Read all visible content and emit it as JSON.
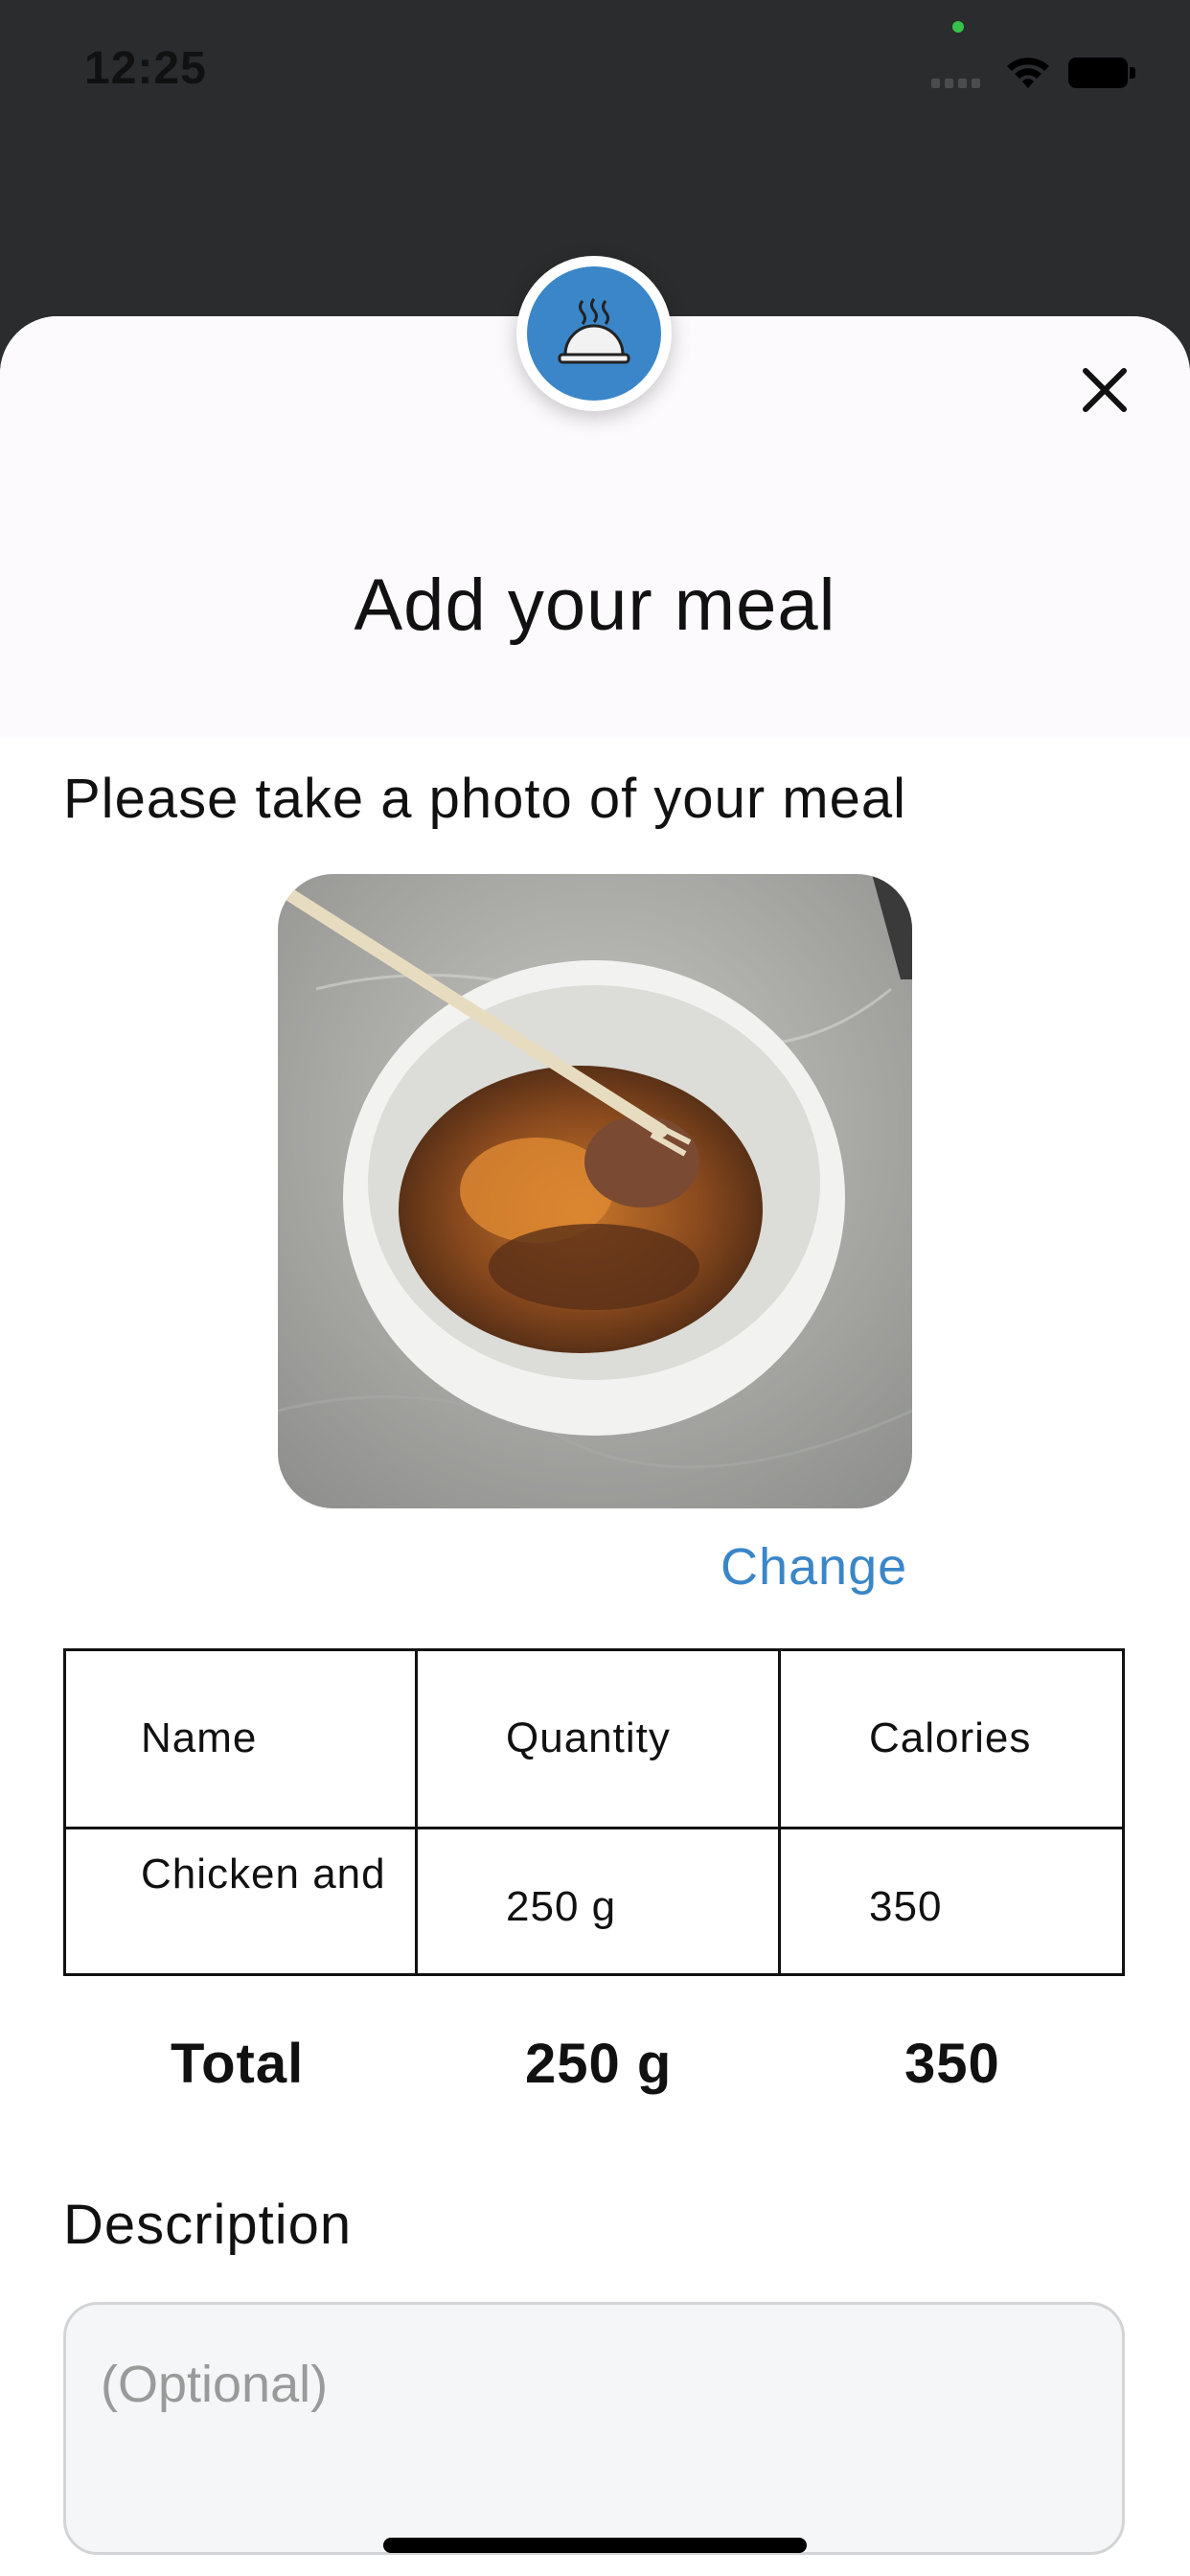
{
  "status_bar": {
    "time": "12:25"
  },
  "sheet": {
    "title": "Add your meal"
  },
  "photo_section": {
    "prompt": "Please take a photo of your meal",
    "change_label": "Change"
  },
  "table": {
    "headers": [
      "Name",
      "Quantity",
      "Calories"
    ],
    "rows": [
      {
        "name": "Chicken and",
        "quantity": "250 g",
        "calories": "350"
      }
    ]
  },
  "totals": {
    "label": "Total",
    "quantity": "250 g",
    "calories": "350"
  },
  "description": {
    "label": "Description",
    "placeholder": "(Optional)"
  },
  "colors": {
    "accent": "#3a86c8",
    "backdrop": "#2a2c2e",
    "status_dot": "#36c24a"
  },
  "icons": [
    "meal-cloche-icon",
    "close-icon",
    "wifi-icon",
    "battery-icon",
    "signal-icon"
  ]
}
